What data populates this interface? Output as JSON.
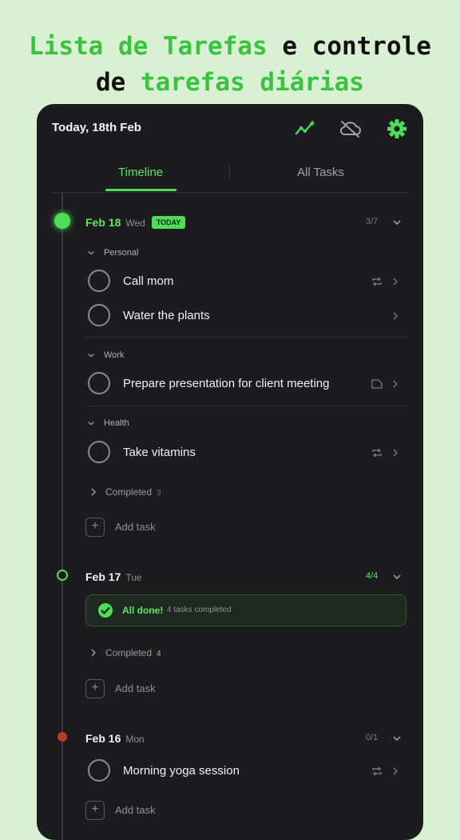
{
  "hero": {
    "line1_green": "Lista de Tarefas",
    "line1_mid": "e",
    "line1_dark": "controle",
    "line2_dark": "de",
    "line2_green": "tarefas diárias"
  },
  "header": {
    "title": "Today, 18th Feb",
    "icons": [
      "stats-sparkle-icon",
      "cloud-off-icon",
      "settings-gear-icon"
    ]
  },
  "tabs": [
    {
      "label": "Timeline",
      "active": true
    },
    {
      "label": "All Tasks",
      "active": false
    }
  ],
  "days": [
    {
      "date": "Feb 18",
      "weekday": "Wed",
      "badge": "TODAY",
      "count": "3/7",
      "groups": [
        {
          "name": "Personal",
          "tasks": [
            {
              "label": "Call mom",
              "icon": "repeat-icon"
            },
            {
              "label": "Water the plants",
              "icon": ""
            }
          ]
        },
        {
          "name": "Work",
          "tasks": [
            {
              "label": "Prepare presentation for client meeting",
              "icon": "note-icon"
            }
          ]
        },
        {
          "name": "Health",
          "tasks": [
            {
              "label": "Take vitamins",
              "icon": "repeat-icon"
            }
          ]
        }
      ],
      "completed_label": "Completed",
      "completed_count": "3",
      "add_task": "Add task"
    },
    {
      "date": "Feb 17",
      "weekday": "Tue",
      "count": "4/4",
      "done_title": "All done!",
      "done_sub": "4 tasks completed",
      "completed_label": "Completed",
      "completed_count": "4",
      "add_task": "Add task"
    },
    {
      "date": "Feb 16",
      "weekday": "Mon",
      "count": "0/1",
      "tasks": [
        {
          "label": "Morning yoga session",
          "icon": "repeat-icon"
        }
      ],
      "add_task": "Add task"
    }
  ],
  "colors": {
    "accent": "#4ddd57",
    "background": "#d9f1d2",
    "card": "#1c1c1e",
    "overdue": "#c0392b"
  }
}
